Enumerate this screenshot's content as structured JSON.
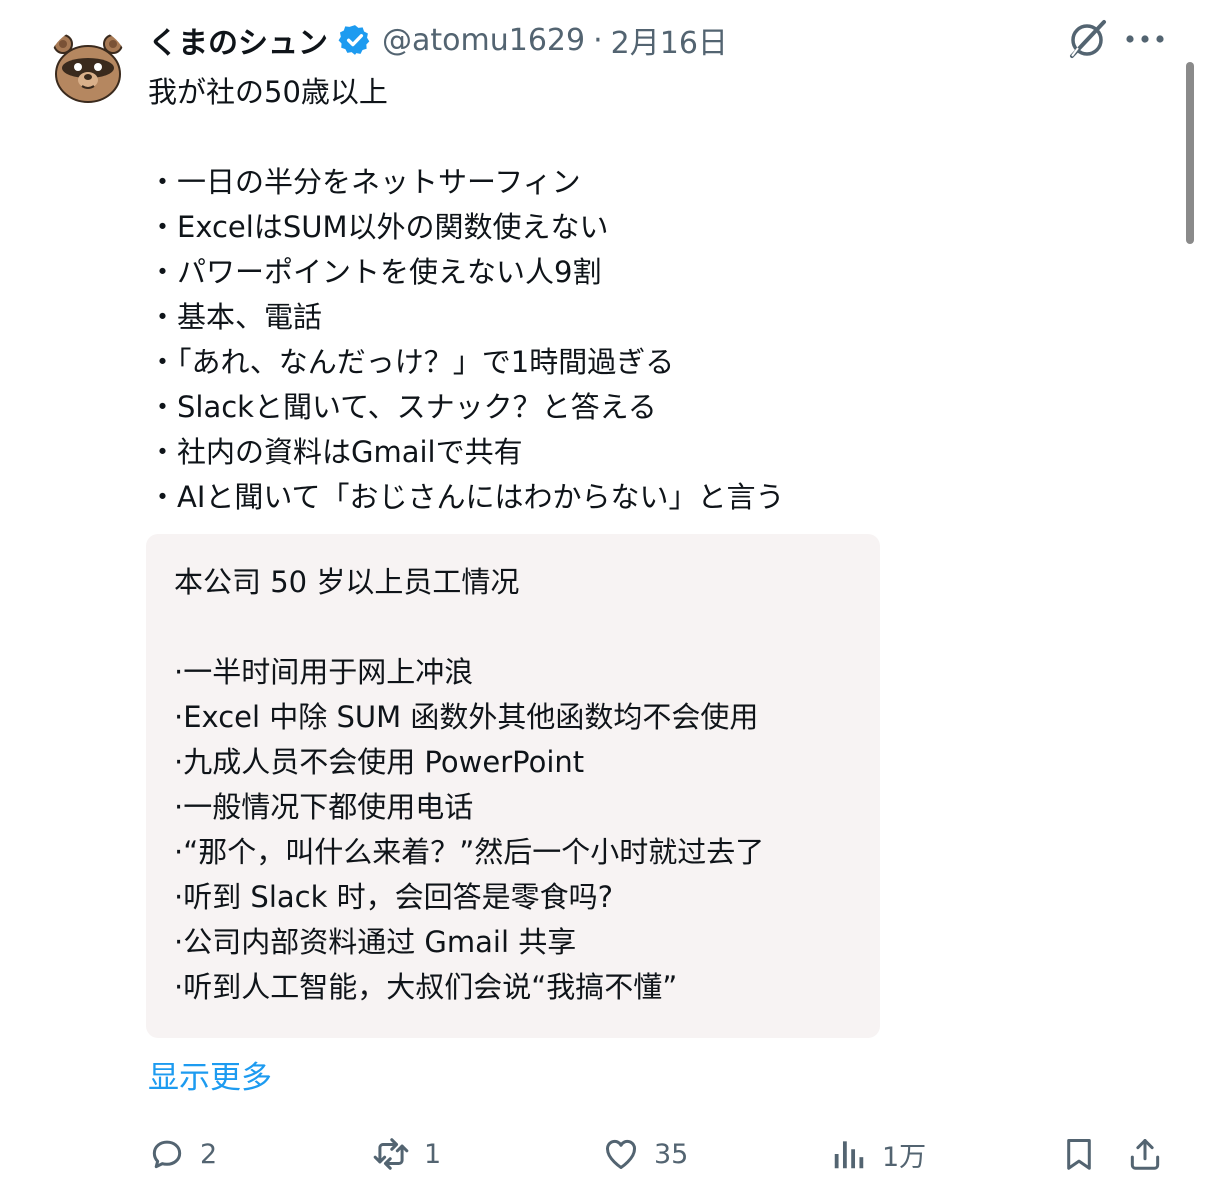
{
  "tweet": {
    "author_name": "くまのシュン",
    "handle": "@atomu1629",
    "separator": "·",
    "date": "2月16日",
    "lines": [
      "我が社の50歳以上",
      "",
      "・一日の半分をネットサーフィン",
      "・ExcelはSUM以外の関数使えない",
      "・パワーポイントを使えない人9割",
      "・基本、電話",
      "・「あれ、なんだっけ？」で1時間過ぎる",
      "・Slackと聞いて、スナック？と答える",
      "・社内の資料はGmailで共有",
      "・AIと聞いて「おじさんにはわからない」と言う"
    ]
  },
  "translation": {
    "lines": [
      "本公司 50 岁以上员工情况",
      "",
      "·一半时间用于网上冲浪",
      "·Excel 中除 SUM 函数外其他函数均不会使用",
      "·九成人员不会使用 PowerPoint",
      "·一般情况下都使用电话",
      "·“那个，叫什么来着？”然后一个小时就过去了",
      "·听到 Slack 时，会回答是零食吗?",
      "·公司内部资料通过 Gmail 共享",
      "·听到人工智能，大叔们会说“我搞不懂”"
    ]
  },
  "show_more": "显示更多",
  "actions": {
    "replies": "2",
    "reposts": "1",
    "likes": "35",
    "views": "1万"
  },
  "icons": [
    "avatar-bear",
    "verified-badge-icon",
    "grok-icon",
    "more-icon",
    "reply-icon",
    "repost-icon",
    "like-icon",
    "views-icon",
    "bookmark-icon",
    "share-icon"
  ],
  "colors": {
    "text": "#0f1419",
    "secondary": "#536471",
    "accent": "#1d9bf0",
    "translation_bg": "#f7f3f3"
  }
}
